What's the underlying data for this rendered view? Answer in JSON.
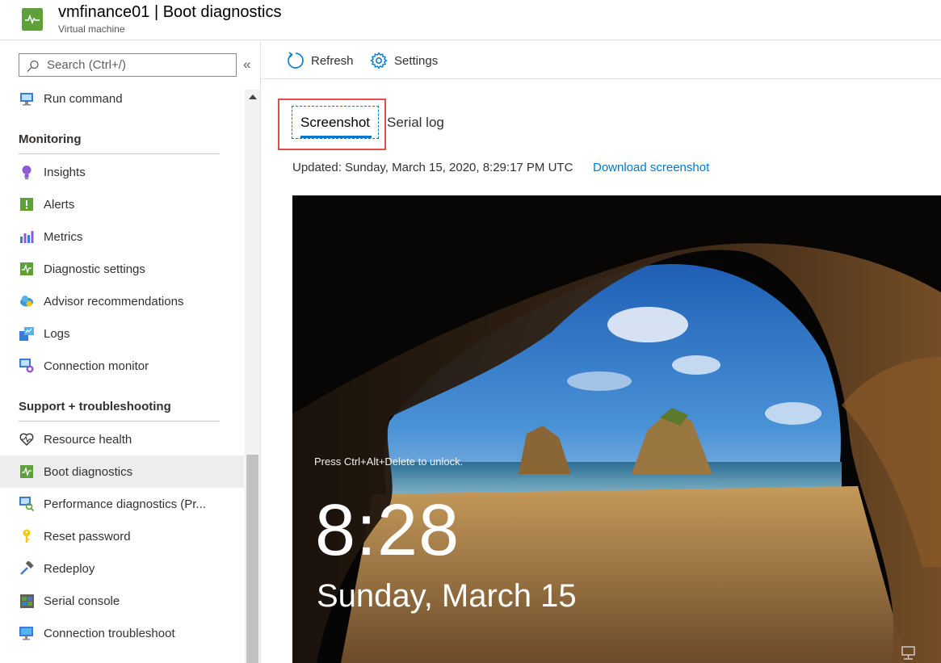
{
  "header": {
    "title": "vmfinance01 | Boot diagnostics",
    "subtitle": "Virtual machine"
  },
  "sidebar": {
    "search_placeholder": "Search (Ctrl+/)",
    "collapse_label": "«",
    "items": [
      {
        "label": "Run command",
        "icon": "run-command-icon"
      },
      {
        "label": "Insights",
        "icon": "insights-icon"
      },
      {
        "label": "Alerts",
        "icon": "alerts-icon"
      },
      {
        "label": "Metrics",
        "icon": "metrics-icon"
      },
      {
        "label": "Diagnostic settings",
        "icon": "diagnostic-settings-icon"
      },
      {
        "label": "Advisor recommendations",
        "icon": "advisor-icon"
      },
      {
        "label": "Logs",
        "icon": "logs-icon"
      },
      {
        "label": "Connection monitor",
        "icon": "connection-monitor-icon"
      },
      {
        "label": "Resource health",
        "icon": "heart-icon"
      },
      {
        "label": "Boot diagnostics",
        "icon": "boot-diagnostics-icon"
      },
      {
        "label": "Performance diagnostics (Pr...",
        "icon": "performance-icon"
      },
      {
        "label": "Reset password",
        "icon": "key-icon"
      },
      {
        "label": "Redeploy",
        "icon": "hammer-icon"
      },
      {
        "label": "Serial console",
        "icon": "serial-console-icon"
      },
      {
        "label": "Connection troubleshoot",
        "icon": "troubleshoot-icon"
      }
    ],
    "sections": {
      "monitoring": "Monitoring",
      "support": "Support + troubleshooting"
    }
  },
  "toolbar": {
    "refresh_label": "Refresh",
    "settings_label": "Settings"
  },
  "tabs": {
    "screenshot": "Screenshot",
    "serial_log": "Serial log"
  },
  "status": {
    "updated": "Updated: Sunday, March 15, 2020, 8:29:17 PM UTC",
    "download_link": "Download screenshot"
  },
  "lockscreen": {
    "message": "Press Ctrl+Alt+Delete to unlock.",
    "time": "8:28",
    "date": "Sunday, March 15"
  },
  "colors": {
    "accent": "#0078d4",
    "highlight": "#e74c4c",
    "vm_green": "#5ea03a"
  }
}
